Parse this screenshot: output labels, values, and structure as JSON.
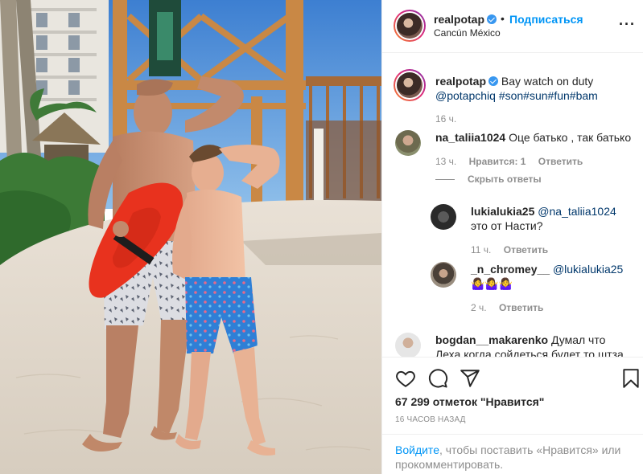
{
  "post": {
    "username": "realpotap",
    "follow_label": "Подписаться",
    "separator": "•",
    "location": "Cancún México",
    "more_icon": "more-options-icon",
    "caption": {
      "username": "realpotap",
      "text": "Bay watch on duty",
      "tags": "@potapchiq #son#sun#fun#bam",
      "time": "16 ч."
    }
  },
  "comments": [
    {
      "username": "na_taliia1024",
      "text": "Оце батько , так батько",
      "time": "13 ч.",
      "likes": "Нравится: 1",
      "reply": "Ответить",
      "hide_replies": "Скрыть ответы"
    },
    {
      "username": "lukialukia25",
      "mention": "@na_taliia1024",
      "text_line1": "это",
      "text_line2": "от Насти?",
      "time": "11 ч.",
      "reply": "Ответить"
    },
    {
      "username": "_n_chromey__",
      "mention": "@lukialukia25",
      "emoji": "🤷‍♀️🤷‍♀️🤷‍♀️",
      "time": "2 ч.",
      "reply": "Ответить"
    },
    {
      "username": "bogdan__makarenko",
      "text": "Думал что Леха",
      "text_line2": "когда сойдеться будет то штза 3 грн!"
    }
  ],
  "actions": {
    "like_icon": "heart-icon",
    "comment_icon": "comment-icon",
    "share_icon": "share-icon",
    "save_icon": "bookmark-icon",
    "likes_text": "67 299 отметок \"Нравится\"",
    "timestamp": "16 ЧАСОВ НАЗАД"
  },
  "login_prompt": {
    "link": "Войдите",
    "text": ", чтобы поставить «Нравится» или прокомментировать."
  },
  "colors": {
    "link_blue": "#0095f6",
    "mention_blue": "#00376b",
    "verified_blue": "#3897f0",
    "muted_grey": "#8e8e8e",
    "buoy_red": "#e8321e"
  }
}
